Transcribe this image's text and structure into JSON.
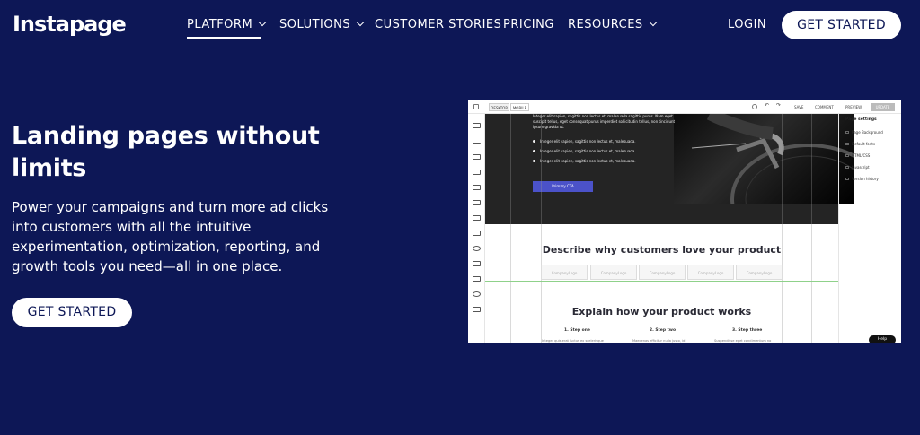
{
  "brand": {
    "logo_text": "Instapage"
  },
  "nav": {
    "items": [
      {
        "label": "PLATFORM",
        "dropdown": true,
        "active": true
      },
      {
        "label": "SOLUTIONS",
        "dropdown": true,
        "active": false
      },
      {
        "label": "CUSTOMER STORIES",
        "dropdown": false,
        "active": false
      },
      {
        "label": "PRICING",
        "dropdown": false,
        "active": false
      },
      {
        "label": "RESOURCES",
        "dropdown": true,
        "active": false
      }
    ],
    "login_label": "LOGIN",
    "cta_label": "GET STARTED"
  },
  "hero": {
    "title": "Landing pages without limits",
    "body": "Power your campaigns and turn more ad clicks into customers with all the intuitive experimentation, optimization, reporting, and growth tools you need—all in one place.",
    "cta_label": "GET STARTED"
  },
  "editor": {
    "view_toggle": [
      "DESKTOP",
      "MOBILE"
    ],
    "top_actions": [
      "SAVE",
      "COMMENT",
      "PREVIEW",
      "UPDATE"
    ],
    "right_panel": {
      "heading": "Page settings",
      "items": [
        "Page Background",
        "Default fonts",
        "HTML/CSS",
        "Javascript",
        "Version history"
      ]
    },
    "content": {
      "paragraph": "Integer elit sapien, sagittis non lectus et, malesuada sagittis purus. Nam eget suscipit tellus, eget consequat purus imperdiet sollicitudin tellus, non tincidunt ipsum gravida ut.",
      "bullets": [
        "Integer elit sapien, sagittis non lectus et, malesuada.",
        "Integer elit sapien, sagittis non lectus et, malesuada.",
        "Integer elit sapien, sagittis non lectus et, malesuada."
      ],
      "cta": "Primary CTA",
      "section1_title": "Describe why customers love your product",
      "logo_label": "CompanyLogo",
      "section2_title": "Explain how your product works",
      "steps": [
        "1. Step one",
        "2. Step two",
        "3. Step three"
      ],
      "step_texts": [
        "Integer quis erat luctus ex scelerisque",
        "Maecenas efficitur nulla justo, id",
        "Suspendisse eget condimentum no"
      ]
    },
    "help_label": "Help"
  },
  "colors": {
    "background": "#0d1756",
    "accent": "#4b52c9"
  }
}
